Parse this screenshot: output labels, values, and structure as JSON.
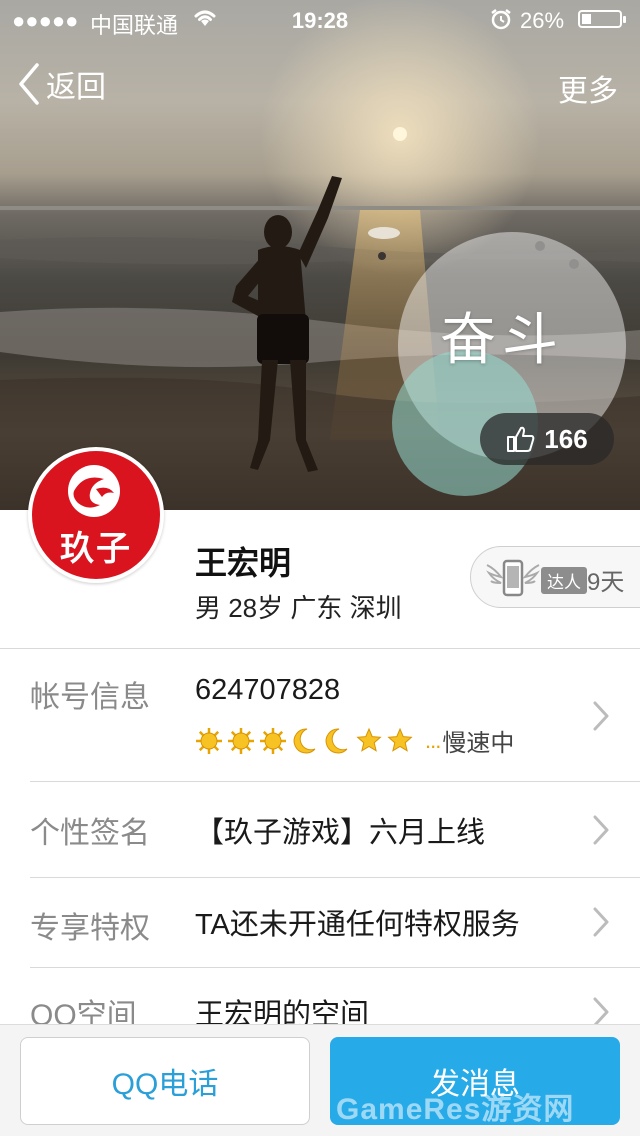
{
  "status_bar": {
    "signal": "●●●●●",
    "carrier": "中国联通",
    "time": "19:28",
    "battery_percent": "26%",
    "battery_level": 0.26
  },
  "nav": {
    "back_label": "返回",
    "more_label": "更多"
  },
  "cover": {
    "tag_text": "奋斗",
    "like_count": "166"
  },
  "profile": {
    "avatar_text": "玖子",
    "name": "王宏明",
    "meta": "男  28岁  广东 深圳",
    "badge_label": "达人",
    "badge_days": "9天"
  },
  "rows": [
    {
      "label": "帐号信息",
      "value": "624707828"
    },
    {
      "label": "个性签名",
      "value": "【玖子游戏】六月上线"
    },
    {
      "label": "专享特权",
      "value": "TA还未开通任何特权服务"
    },
    {
      "label": "QQ空间",
      "value": "王宏明的空间"
    }
  ],
  "level": {
    "icons": [
      "sun-icon",
      "sun-icon",
      "sun-icon",
      "moon-icon",
      "moon-icon",
      "star-icon",
      "star-icon"
    ],
    "dots": "...",
    "speed_text": "慢速中"
  },
  "bottom": {
    "call_label": "QQ电话",
    "message_label": "发消息"
  },
  "watermark": "GameRes游资网",
  "colors": {
    "accent": "#27aae8",
    "call_text": "#2a9fd8",
    "avatar_red": "#d9141f"
  }
}
